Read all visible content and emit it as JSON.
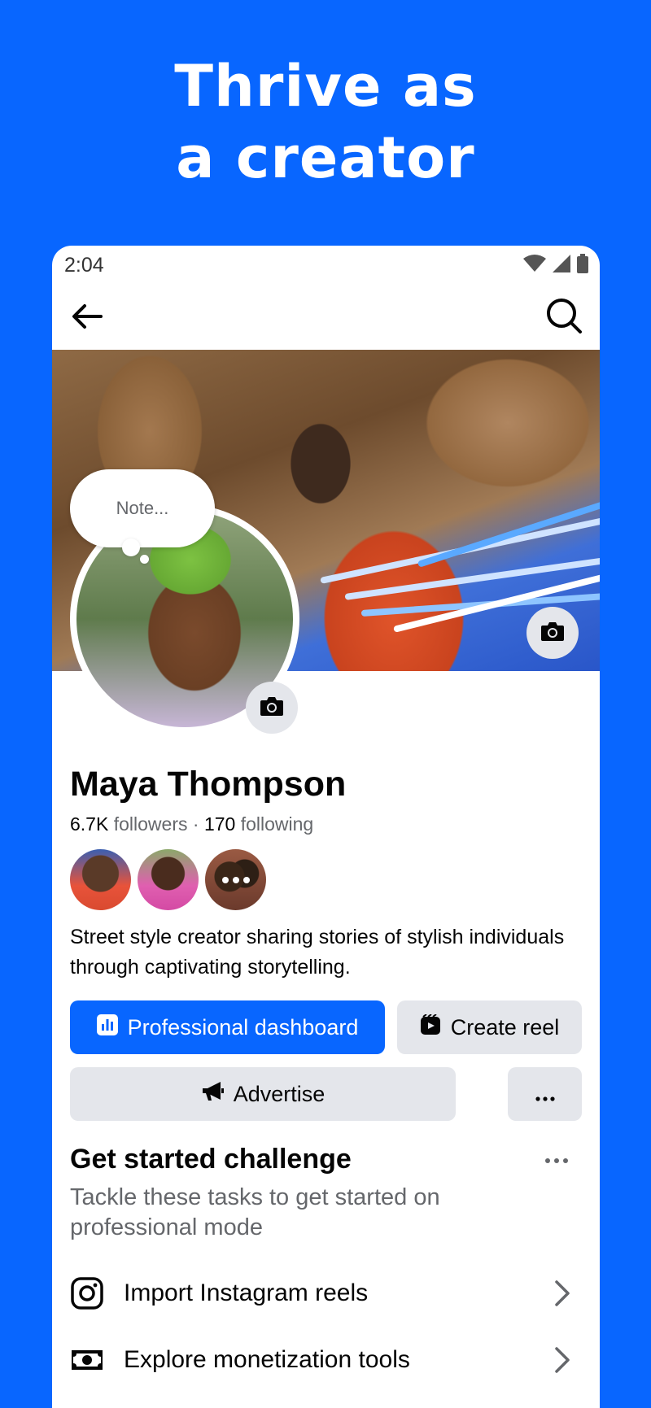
{
  "hero": {
    "line1": "Thrive as",
    "line2": "a creator"
  },
  "status_bar": {
    "time": "2:04",
    "icons": [
      "wifi-icon",
      "signal-icon",
      "battery-icon"
    ]
  },
  "nav": {
    "back_icon": "arrow-left-icon",
    "search_icon": "search-icon"
  },
  "profile": {
    "note_placeholder": "Note...",
    "name": "Maya Thompson",
    "followers_count": "6.7K",
    "followers_label": "followers",
    "separator": "·",
    "following_count": "170",
    "following_label": "following",
    "bio": "Street style creator sharing stories of stylish individuals through captivating storytelling."
  },
  "actions": {
    "professional_dashboard": "Professional dashboard",
    "create_reel": "Create reel",
    "advertise": "Advertise",
    "more": "more-icon"
  },
  "challenge": {
    "title": "Get started challenge",
    "subtitle": "Tackle these tasks to get started on professional mode",
    "tasks": [
      {
        "label": "Import Instagram reels",
        "icon": "instagram-icon"
      },
      {
        "label": "Explore monetization tools",
        "icon": "money-icon"
      }
    ]
  },
  "colors": {
    "brand_blue": "#0866FF",
    "button_gray": "#E4E6EB",
    "secondary_text": "#65676B"
  }
}
